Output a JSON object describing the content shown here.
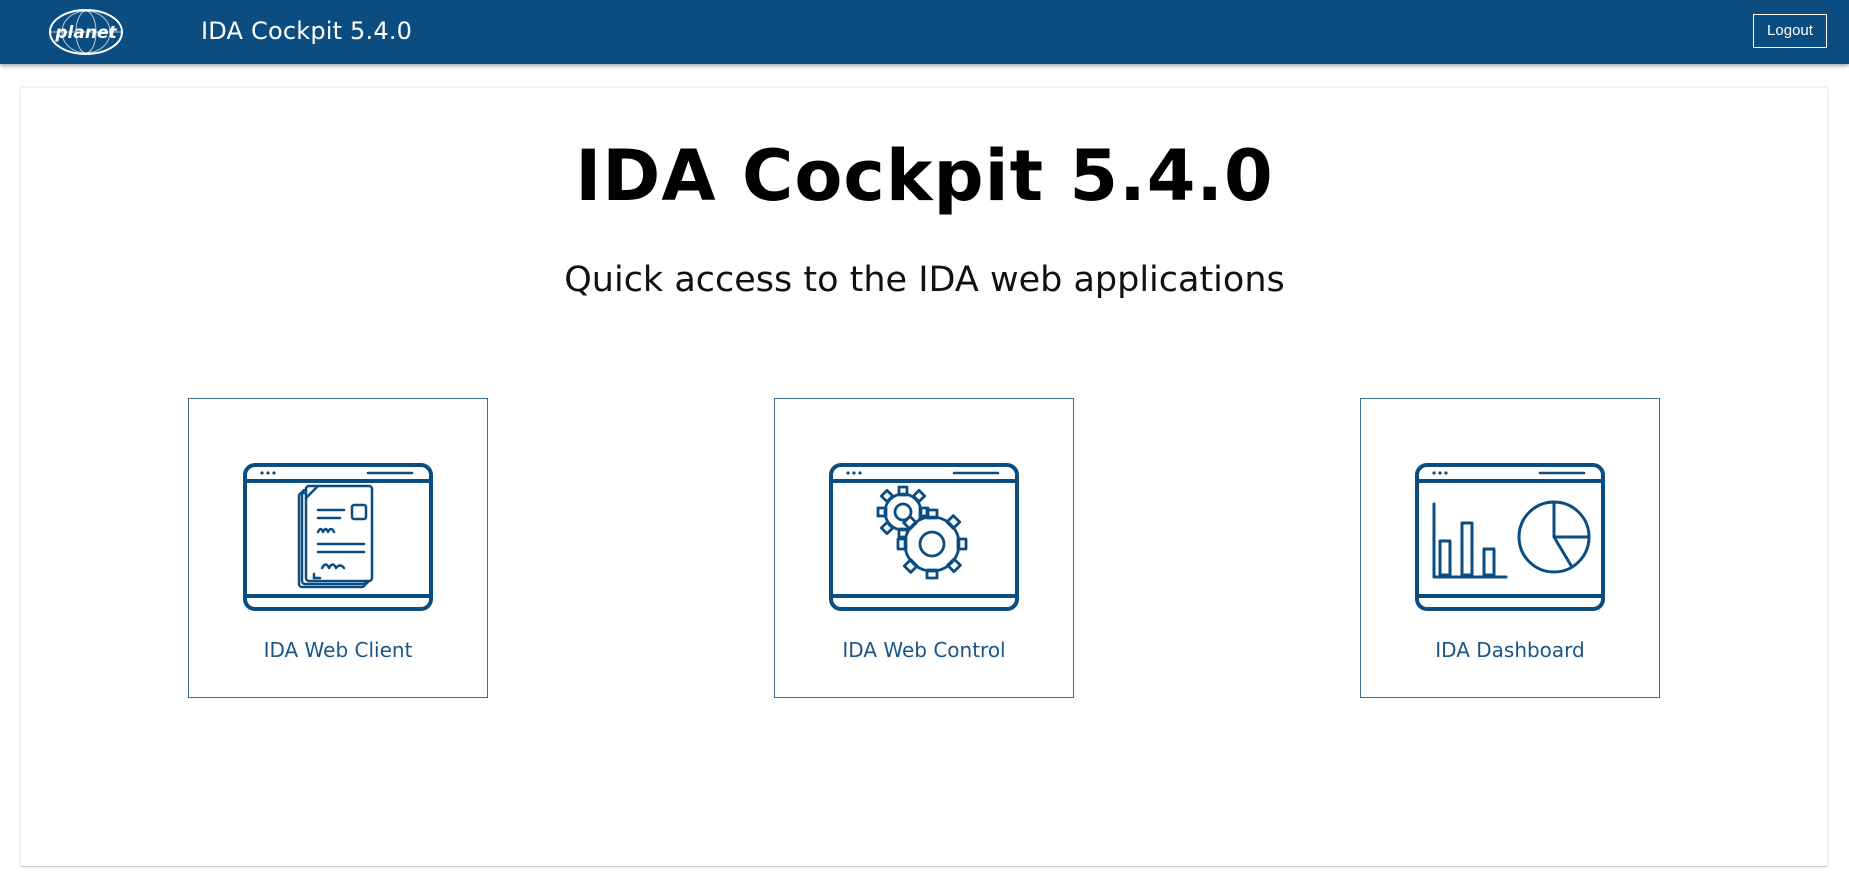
{
  "header": {
    "logo_icon": "planet-logo",
    "title": "IDA Cockpit 5.4.0",
    "logout_label": "Logout",
    "background": "#0b4d80"
  },
  "main": {
    "title": "IDA Cockpit 5.4.0",
    "subtitle": "Quick access to the IDA web applications",
    "tiles": [
      {
        "label": "IDA Web Client",
        "icon": "document-window-icon"
      },
      {
        "label": "IDA Web Control",
        "icon": "gears-window-icon"
      },
      {
        "label": "IDA Dashboard",
        "icon": "charts-window-icon"
      }
    ],
    "accent": "#0b4d80"
  }
}
